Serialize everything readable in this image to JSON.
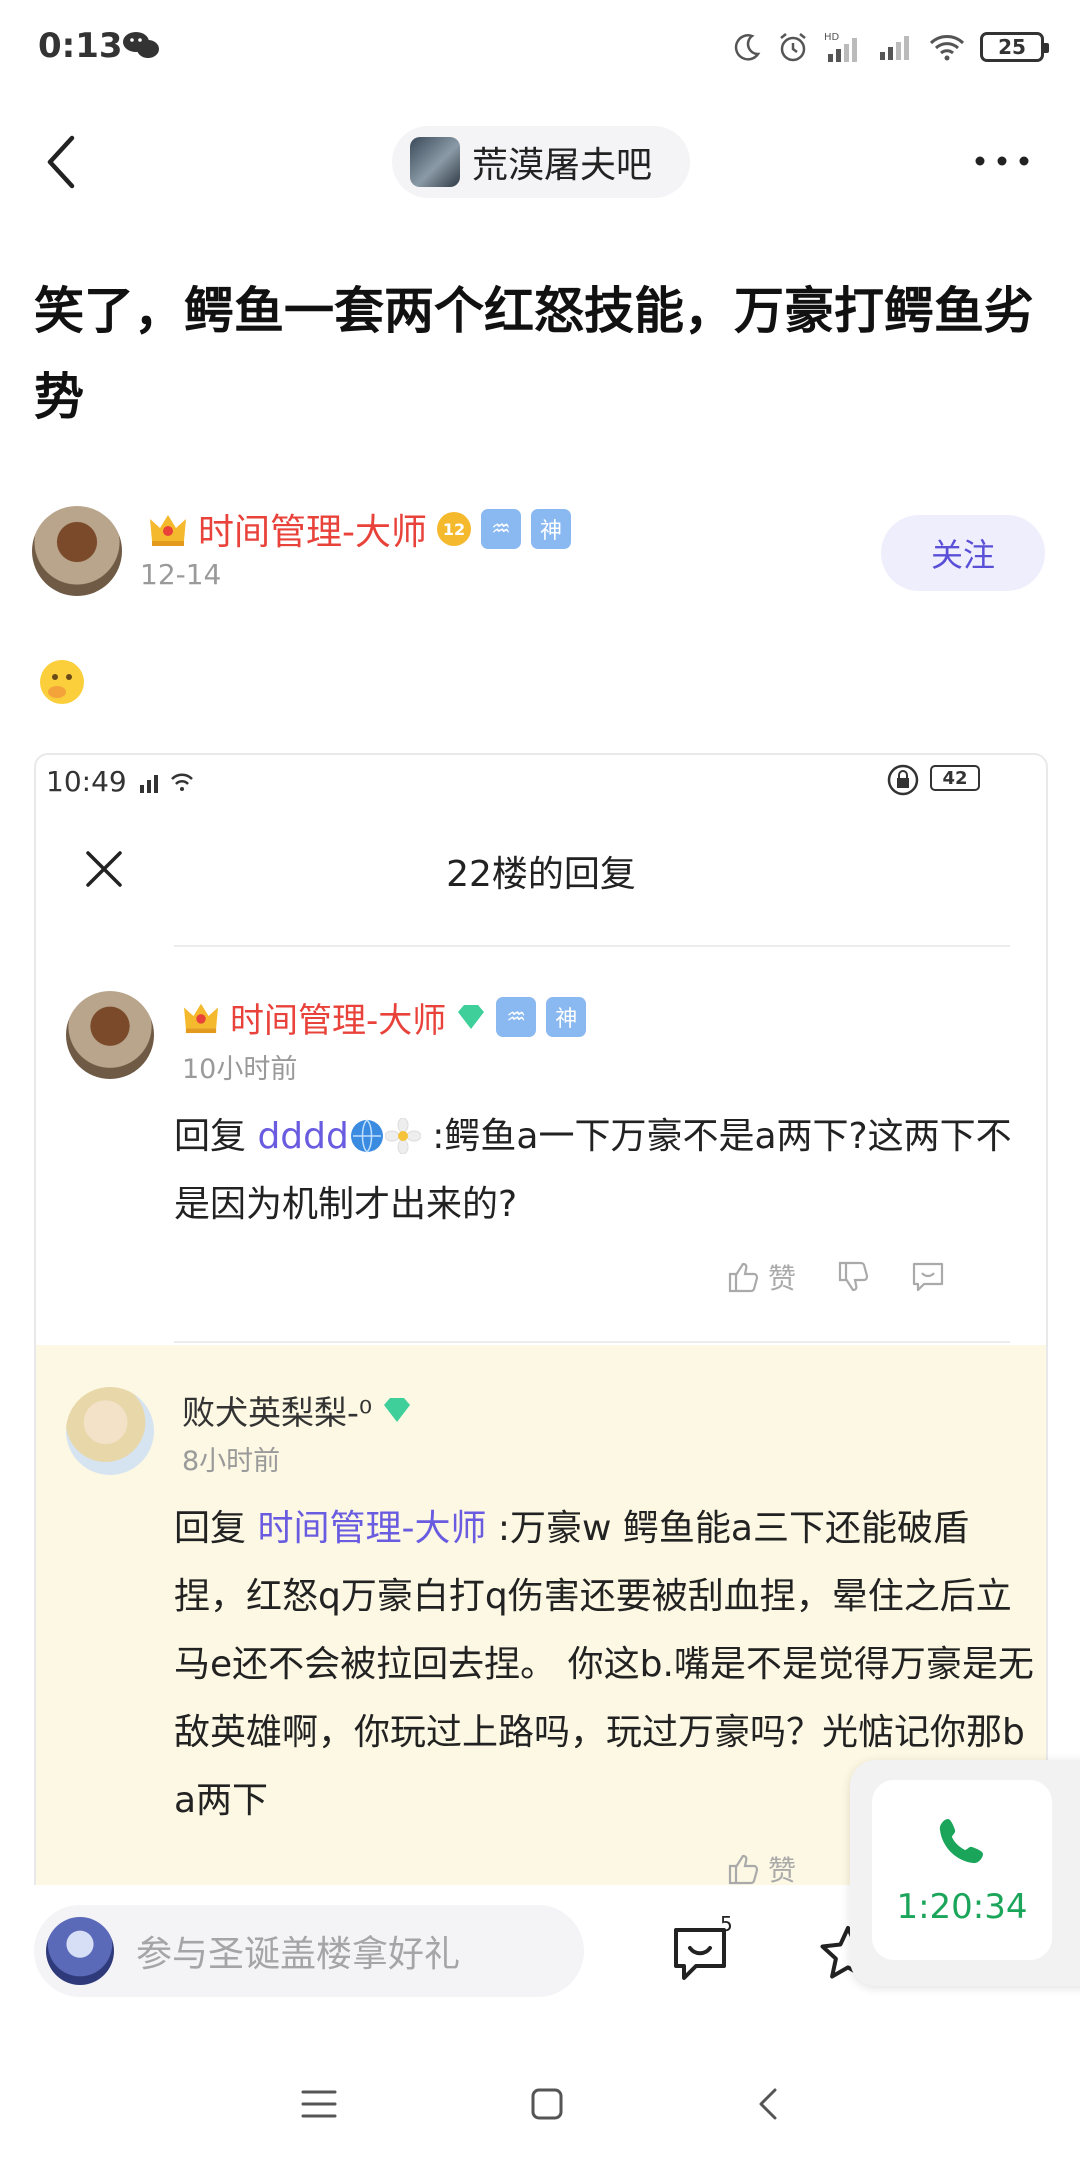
{
  "status_bar": {
    "time": "0:13",
    "battery": "25"
  },
  "header": {
    "forum_name": "荒漠屠夫吧"
  },
  "post": {
    "title": "笑了，鳄鱼一套两个红怒技能，万豪打鳄鱼劣势",
    "author": "时间管理-大师",
    "level": "12",
    "date": "12-14",
    "follow_label": "关注"
  },
  "screenshot": {
    "time": "10:49",
    "battery": "42",
    "title": "22楼的回复",
    "reply1": {
      "author": "时间管理-大师",
      "time": "10小时前",
      "prefix": "回复 ",
      "reply_to": "dddd",
      "text": " :鳄鱼a一下万豪不是a两下?这两下不是因为机制才出来的?",
      "like_label": "赞"
    },
    "reply2": {
      "author": "败犬英梨梨-⁰",
      "time": "8小时前",
      "prefix": "回复 ",
      "reply_to": "时间管理-大师",
      "text": " :万豪w 鳄鱼能a三下还能破盾捏，红怒q万豪白打q伤害还要被刮血捏，晕住之后立马e还不会被拉回去捏。 你这b.嘴是不是觉得万豪是无敌英雄啊，你玩过上路吗，玩过万豪吗？光惦记你那b a两下",
      "like_label": "赞"
    }
  },
  "call": {
    "duration": "1:20:34"
  },
  "bottom_bar": {
    "placeholder": "参与圣诞盖楼拿好礼",
    "comment_count": "5"
  },
  "badges": {
    "aquarius": "♒",
    "god": "神"
  },
  "colors": {
    "accent_purple": "#5a50d8",
    "name_red": "#e8423a",
    "call_green": "#1aa55a",
    "highlight_bg": "#fcf8e3"
  }
}
